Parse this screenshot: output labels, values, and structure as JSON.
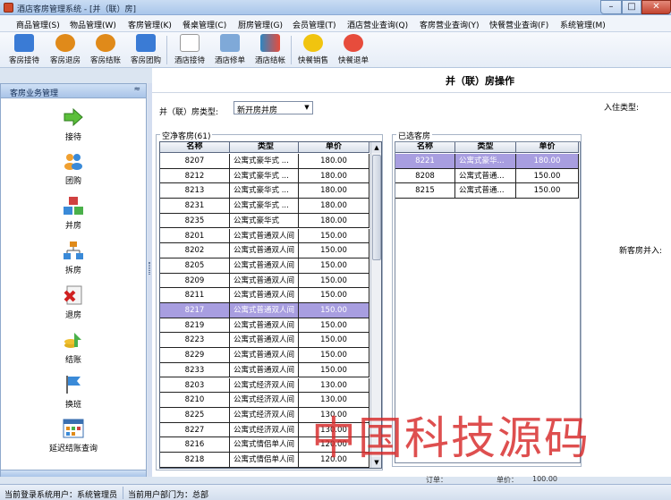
{
  "window": {
    "title": "酒店客房管理系统 - [并（联）房]"
  },
  "menu": [
    "商品管理(S)",
    "物品管理(W)",
    "客房管理(K)",
    "餐桌管理(C)",
    "厨房管理(G)",
    "会员管理(T)",
    "酒店营业查询(Q)",
    "客房营业查询(Y)",
    "快餐营业查询(F)",
    "系统管理(M)"
  ],
  "toolbar": [
    {
      "label": "客房接待",
      "icon": "reception-icon",
      "color": "#3a7bd5"
    },
    {
      "label": "客房退房",
      "icon": "checkout-icon",
      "color": "#e08a1a"
    },
    {
      "label": "客房结账",
      "icon": "settle-icon",
      "color": "#e08a1a"
    },
    {
      "label": "客房团购",
      "icon": "group-buy-icon",
      "color": "#3a7bd5"
    },
    {
      "label": "酒店接待",
      "icon": "hotel-reception-icon",
      "color": "#c0392b"
    },
    {
      "label": "酒店修单",
      "icon": "modify-order-icon",
      "color": "#3a7bd5"
    },
    {
      "label": "酒店结帐",
      "icon": "hotel-settle-icon",
      "color": "#2e86c1"
    },
    {
      "label": "快餐销售",
      "icon": "fastfood-sale-icon",
      "color": "#f1c40f"
    },
    {
      "label": "快餐退单",
      "icon": "fastfood-refund-icon",
      "color": "#e74c3c"
    }
  ],
  "sidebar": {
    "header": "客房业务管理",
    "collapse": "≈",
    "items": [
      {
        "label": "接待",
        "icon": "arrow-right-icon"
      },
      {
        "label": "团购",
        "icon": "group-icon"
      },
      {
        "label": "并房",
        "icon": "merge-icon"
      },
      {
        "label": "拆房",
        "icon": "split-icon"
      },
      {
        "label": "退房",
        "icon": "checkout-icon"
      },
      {
        "label": "结账",
        "icon": "settle-icon"
      },
      {
        "label": "换班",
        "icon": "flag-icon"
      },
      {
        "label": "延迟结账查询",
        "icon": "calendar-icon"
      }
    ]
  },
  "main": {
    "title": "并（联）房操作",
    "room_type_label": "并（联）房类型:",
    "room_type_value": "新开房并房",
    "checkin_type_label": "入住类型:",
    "new_room_label": "新客房并入:",
    "bottom_fragment_1": "订单：",
    "bottom_fragment_2": "单价：",
    "bottom_fragment_3": "100.00",
    "available": {
      "title": "空净客房(61)",
      "columns": [
        "名称",
        "类型",
        "单价"
      ],
      "rows": [
        [
          "8207",
          "公寓式豪华式 ...",
          "180.00"
        ],
        [
          "8212",
          "公寓式豪华式 ...",
          "180.00"
        ],
        [
          "8213",
          "公寓式豪华式 ...",
          "180.00"
        ],
        [
          "8231",
          "公寓式豪华式 ...",
          "180.00"
        ],
        [
          "8235",
          "公寓式豪华式",
          "180.00"
        ],
        [
          "8201",
          "公寓式普通双人间",
          "150.00"
        ],
        [
          "8202",
          "公寓式普通双人间",
          "150.00"
        ],
        [
          "8205",
          "公寓式普通双人间",
          "150.00"
        ],
        [
          "8209",
          "公寓式普通双人间",
          "150.00"
        ],
        [
          "8211",
          "公寓式普通双人间",
          "150.00"
        ],
        [
          "8217",
          "公寓式普通双人间",
          "150.00"
        ],
        [
          "8219",
          "公寓式普通双人间",
          "150.00"
        ],
        [
          "8223",
          "公寓式普通双人间",
          "150.00"
        ],
        [
          "8229",
          "公寓式普通双人间",
          "150.00"
        ],
        [
          "8233",
          "公寓式普通双人间",
          "150.00"
        ],
        [
          "8203",
          "公寓式经济双人间",
          "130.00"
        ],
        [
          "8210",
          "公寓式经济双人间",
          "130.00"
        ],
        [
          "8225",
          "公寓式经济双人间",
          "130.00"
        ],
        [
          "8227",
          "公寓式经济双人间",
          "130.00"
        ],
        [
          "8216",
          "公寓式情侣单人间",
          "120.00"
        ],
        [
          "8218",
          "公寓式情侣单人间",
          "120.00"
        ]
      ],
      "selected_index": 10
    },
    "chosen": {
      "title": "已选客房",
      "columns": [
        "名称",
        "类型",
        "单价"
      ],
      "rows": [
        [
          "8221",
          "公寓式豪华...",
          "180.00"
        ],
        [
          "8208",
          "公寓式普通...",
          "150.00"
        ],
        [
          "8215",
          "公寓式普通...",
          "150.00"
        ]
      ],
      "selected_index": 0
    }
  },
  "watermark": "中国科技源码",
  "status": {
    "user": "当前登录系统用户：系统管理员",
    "dept": "当前用户部门为：总部"
  }
}
